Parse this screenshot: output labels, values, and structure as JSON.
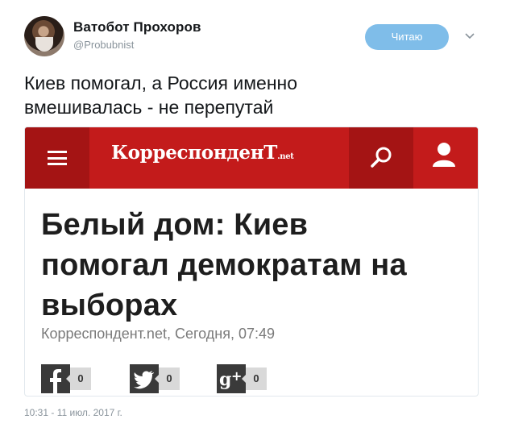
{
  "tweet": {
    "display_name": "Ватобот Прохоров",
    "handle": "@Probubnist",
    "follow_label": "Читаю",
    "text_line1": "Киев помогал, а Россия именно",
    "text_line2": "вмешивалась - не перепутай",
    "timestamp": "10:31 - 11 июл. 2017 г."
  },
  "card": {
    "site_logo": "КорреспонденТ",
    "site_logo_suffix": ".net",
    "headline_line1": "Белый дом: Киев",
    "headline_line2": "помогал демократам на",
    "headline_line3": "выборах",
    "meta": "Корреспондент.net, Сегодня, 07:49",
    "share": [
      {
        "network": "facebook",
        "count": "0"
      },
      {
        "network": "twitter",
        "count": "0"
      },
      {
        "network": "google-plus",
        "count": "0"
      }
    ]
  },
  "colors": {
    "accent_follow": "#7fbde9",
    "site_red": "#c31b1b",
    "site_red_dark": "#a41414"
  },
  "icons": {
    "menu": "hamburger-icon",
    "search": "search-icon",
    "user": "user-icon",
    "caret": "chevron-down-icon"
  }
}
